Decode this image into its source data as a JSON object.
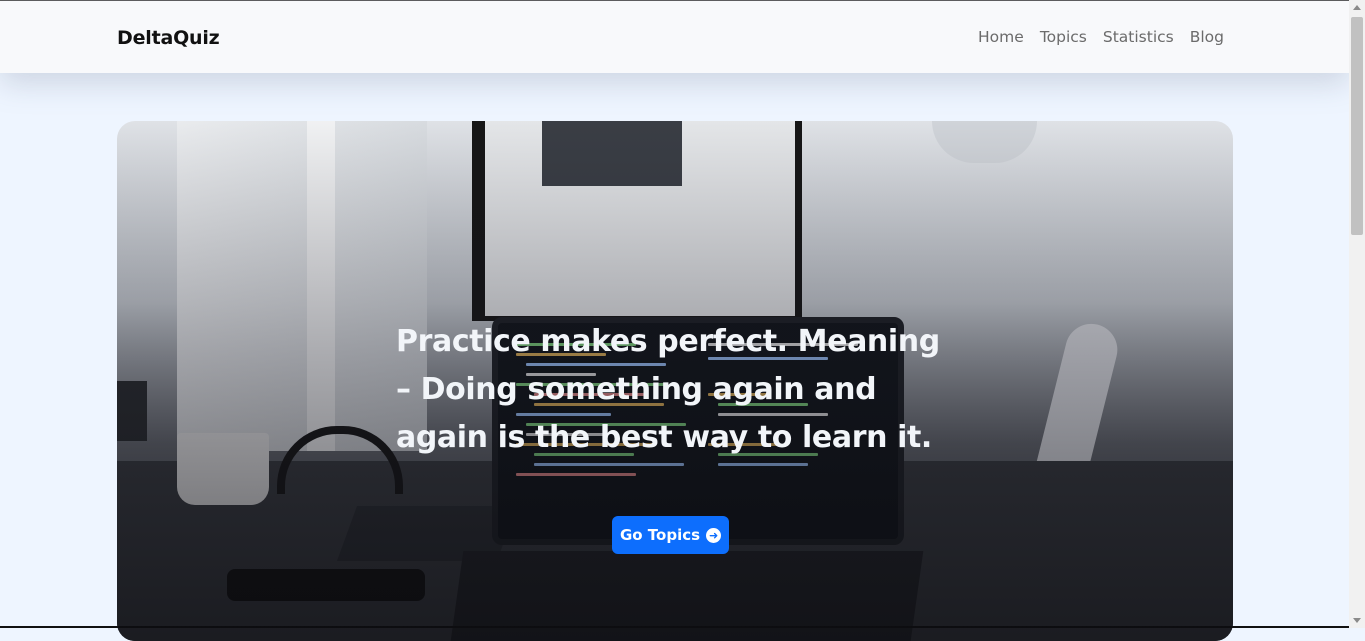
{
  "navbar": {
    "brand": "DeltaQuiz",
    "links": [
      "Home",
      "Topics",
      "Statistics",
      "Blog"
    ]
  },
  "hero": {
    "headline": "Practice makes perfect. Meaning – Doing something again and again is the best way to learn it.",
    "cta_label": "Go Topics",
    "cta_icon": "arrow-right-circle-icon"
  },
  "colors": {
    "accent": "#0d6efd",
    "page_bg": "#eef5ff",
    "navbar_bg": "#f8f9fb"
  }
}
